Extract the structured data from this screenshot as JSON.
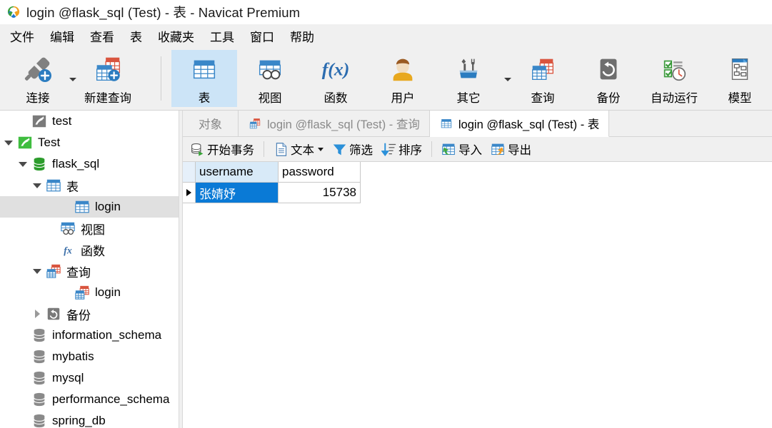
{
  "window": {
    "title": "login @flask_sql (Test) - 表 - Navicat Premium",
    "logo_icon": "navicat-logo-icon"
  },
  "menubar": {
    "items": [
      {
        "label": "文件",
        "name": "menu-file"
      },
      {
        "label": "编辑",
        "name": "menu-edit"
      },
      {
        "label": "查看",
        "name": "menu-view"
      },
      {
        "label": "表",
        "name": "menu-table"
      },
      {
        "label": "收藏夹",
        "name": "menu-favorites"
      },
      {
        "label": "工具",
        "name": "menu-tools"
      },
      {
        "label": "窗口",
        "name": "menu-window"
      },
      {
        "label": "帮助",
        "name": "menu-help"
      }
    ]
  },
  "ribbon": {
    "buttons": [
      {
        "label": "连接",
        "icon": "connection-icon",
        "name": "ribbon-connection",
        "selected": false,
        "caret": true
      },
      {
        "label": "新建查询",
        "icon": "new-query-icon",
        "name": "ribbon-new-query",
        "selected": false,
        "caret": false
      },
      {
        "label": "表",
        "icon": "table-icon",
        "name": "ribbon-table",
        "selected": true,
        "caret": false
      },
      {
        "label": "视图",
        "icon": "view-icon",
        "name": "ribbon-view",
        "selected": false,
        "caret": false
      },
      {
        "label": "函数",
        "icon": "function-fx-icon",
        "name": "ribbon-function",
        "selected": false,
        "caret": false
      },
      {
        "label": "用户",
        "icon": "user-icon",
        "name": "ribbon-user",
        "selected": false,
        "caret": false
      },
      {
        "label": "其它",
        "icon": "other-tools-icon",
        "name": "ribbon-other",
        "selected": false,
        "caret": true
      },
      {
        "label": "查询",
        "icon": "query-icon",
        "name": "ribbon-query",
        "selected": false,
        "caret": false
      },
      {
        "label": "备份",
        "icon": "backup-icon",
        "name": "ribbon-backup",
        "selected": false,
        "caret": false
      },
      {
        "label": "自动运行",
        "icon": "automation-icon",
        "name": "ribbon-automation",
        "selected": false,
        "caret": false
      },
      {
        "label": "模型",
        "icon": "model-icon",
        "name": "ribbon-model",
        "selected": false,
        "caret": false
      }
    ]
  },
  "sidebar": {
    "items": [
      {
        "label": "test",
        "icon": "connection-gray-icon",
        "indent": 1,
        "twisty": "none",
        "selected": false,
        "name": "tree-item-test"
      },
      {
        "label": "Test",
        "icon": "connection-green-icon",
        "indent": 0,
        "twisty": "down",
        "selected": false,
        "name": "tree-item-Test"
      },
      {
        "label": "flask_sql",
        "icon": "database-green-icon",
        "indent": 1,
        "twisty": "down",
        "selected": false,
        "name": "tree-item-flask-sql"
      },
      {
        "label": "表",
        "icon": "table-icon",
        "indent": 2,
        "twisty": "down",
        "selected": false,
        "name": "tree-item-tables"
      },
      {
        "label": "login",
        "icon": "table-icon",
        "indent": 4,
        "twisty": "none",
        "selected": true,
        "name": "tree-item-login-table"
      },
      {
        "label": "视图",
        "icon": "view-icon",
        "indent": 3,
        "twisty": "none",
        "selected": false,
        "name": "tree-item-views"
      },
      {
        "label": "函数",
        "icon": "function-fx-icon",
        "indent": 3,
        "twisty": "none",
        "selected": false,
        "name": "tree-item-functions"
      },
      {
        "label": "查询",
        "icon": "query-icon",
        "indent": 2,
        "twisty": "down",
        "selected": false,
        "name": "tree-item-queries"
      },
      {
        "label": "login",
        "icon": "query-icon",
        "indent": 4,
        "twisty": "none",
        "selected": false,
        "name": "tree-item-login-query"
      },
      {
        "label": "备份",
        "icon": "backup-icon",
        "indent": 2,
        "twisty": "right",
        "selected": false,
        "name": "tree-item-backups"
      },
      {
        "label": "information_schema",
        "icon": "database-gray-icon",
        "indent": 1,
        "twisty": "none",
        "selected": false,
        "name": "tree-item-information-schema"
      },
      {
        "label": "mybatis",
        "icon": "database-gray-icon",
        "indent": 1,
        "twisty": "none",
        "selected": false,
        "name": "tree-item-mybatis"
      },
      {
        "label": "mysql",
        "icon": "database-gray-icon",
        "indent": 1,
        "twisty": "none",
        "selected": false,
        "name": "tree-item-mysql"
      },
      {
        "label": "performance_schema",
        "icon": "database-gray-icon",
        "indent": 1,
        "twisty": "none",
        "selected": false,
        "name": "tree-item-performance-schema"
      },
      {
        "label": "spring_db",
        "icon": "database-gray-icon",
        "indent": 1,
        "twisty": "none",
        "selected": false,
        "name": "tree-item-spring-db"
      }
    ]
  },
  "tabs": [
    {
      "label": "对象",
      "icon": null,
      "state": "object",
      "name": "tab-objects"
    },
    {
      "label": "login @flask_sql (Test) - 查询",
      "icon": "query-icon",
      "state": "inactive",
      "name": "tab-login-query"
    },
    {
      "label": "login @flask_sql (Test) - 表",
      "icon": "table-icon",
      "state": "active",
      "name": "tab-login-table"
    }
  ],
  "grid_toolbar": {
    "buttons": [
      {
        "label": "开始事务",
        "icon": "begin-transaction-icon",
        "name": "begin-transaction-button",
        "caret": false
      },
      {
        "label": "文本",
        "icon": "text-document-icon",
        "name": "text-button",
        "caret": true
      },
      {
        "label": "筛选",
        "icon": "filter-funnel-icon",
        "name": "filter-button",
        "caret": false
      },
      {
        "label": "排序",
        "icon": "sort-icon",
        "name": "sort-button",
        "caret": false
      },
      {
        "label": "导入",
        "icon": "import-icon",
        "name": "import-button",
        "caret": false
      },
      {
        "label": "导出",
        "icon": "export-icon",
        "name": "export-button",
        "caret": false
      }
    ]
  },
  "grid": {
    "columns": [
      {
        "label": "username",
        "header_highlighted": true
      },
      {
        "label": "password",
        "header_highlighted": false
      }
    ],
    "rows": [
      {
        "marker": true,
        "username": "张婧妤",
        "password": "15738",
        "username_selected": true
      }
    ]
  },
  "colors": {
    "accent_blue": "#0a7ad6",
    "ribbon_selected": "#cce4f7",
    "header_highlight": "#d8eaf8",
    "chrome_gray": "#f0f0f0",
    "tree_selected": "#e0e0e0"
  }
}
